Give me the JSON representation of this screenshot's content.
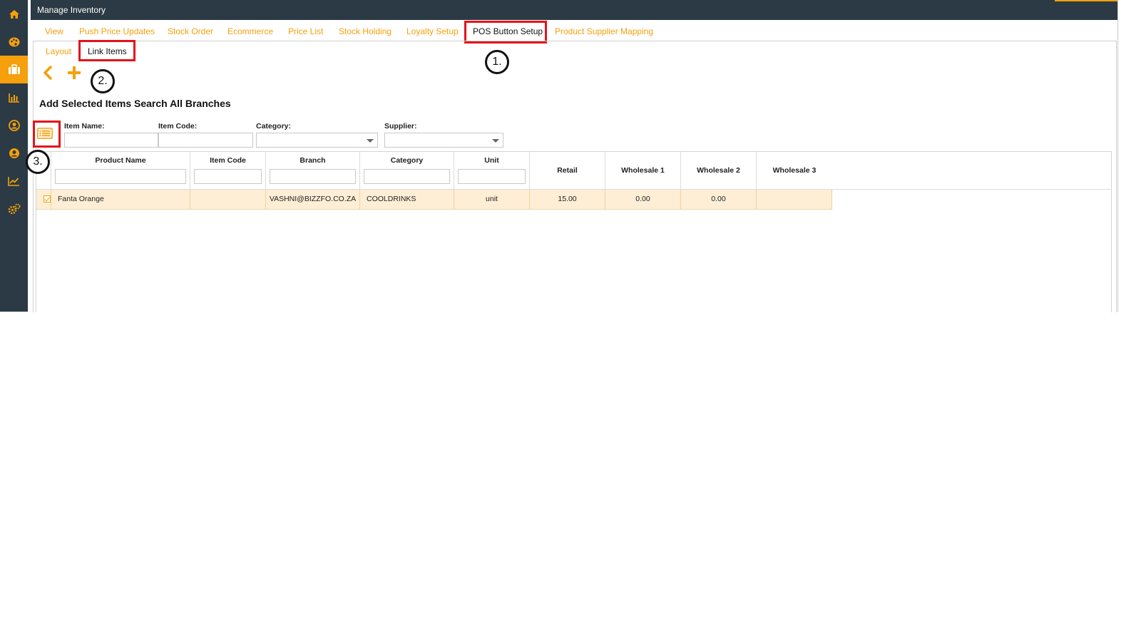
{
  "window": {
    "title": "Manage Inventory"
  },
  "sidebar": {
    "items": [
      {
        "name": "home",
        "icon": "home-icon"
      },
      {
        "name": "palette",
        "icon": "palette-icon"
      },
      {
        "name": "inventory",
        "icon": "briefcase-icon",
        "active": true
      },
      {
        "name": "reports",
        "icon": "bar-chart-icon"
      },
      {
        "name": "customers",
        "icon": "user-circle-icon"
      },
      {
        "name": "users",
        "icon": "user-icon"
      },
      {
        "name": "analytics",
        "icon": "line-chart-icon"
      },
      {
        "name": "settings",
        "icon": "gears-icon"
      }
    ]
  },
  "top_tabs": [
    {
      "label": "View"
    },
    {
      "label": "Push Price Updates"
    },
    {
      "label": "Stock Order"
    },
    {
      "label": "Ecommerce"
    },
    {
      "label": "Price List"
    },
    {
      "label": "Stock Holding"
    },
    {
      "label": "Loyalty Setup"
    },
    {
      "label": "POS Button Setup",
      "active": true
    },
    {
      "label": "Product Supplier Mapping"
    }
  ],
  "sub_tabs": [
    {
      "label": "Layout"
    },
    {
      "label": "Link Items",
      "active": true
    }
  ],
  "callouts": [
    "1.",
    "2.",
    "3."
  ],
  "actions": {
    "add_selected": "Add Selected Items",
    "search_all": "Search All Branches"
  },
  "filters": {
    "item_name": {
      "label": "Item Name:",
      "value": ""
    },
    "item_code": {
      "label": "Item Code:",
      "value": ""
    },
    "category": {
      "label": "Category:",
      "value": ""
    },
    "supplier": {
      "label": "Supplier:",
      "value": ""
    }
  },
  "table": {
    "columns": [
      "Product Name",
      "Item Code",
      "Branch",
      "Category",
      "Unit",
      "Retail",
      "Wholesale 1",
      "Wholesale 2",
      "Wholesale 3"
    ],
    "rows": [
      {
        "checked": true,
        "product_name": "Fanta Orange",
        "item_code": "",
        "branch": "VASHNI@BIZZFO.CO.ZA",
        "category": "COOLDRINKS",
        "unit": "unit",
        "retail": "15.00",
        "wholesale_1": "0.00",
        "wholesale_2": "0.00",
        "wholesale_3": ""
      }
    ]
  },
  "colors": {
    "accent": "#f5a00c",
    "sidebar": "#2b3a44",
    "highlight_box": "#e3131b",
    "row_selected": "#fdeed5"
  }
}
